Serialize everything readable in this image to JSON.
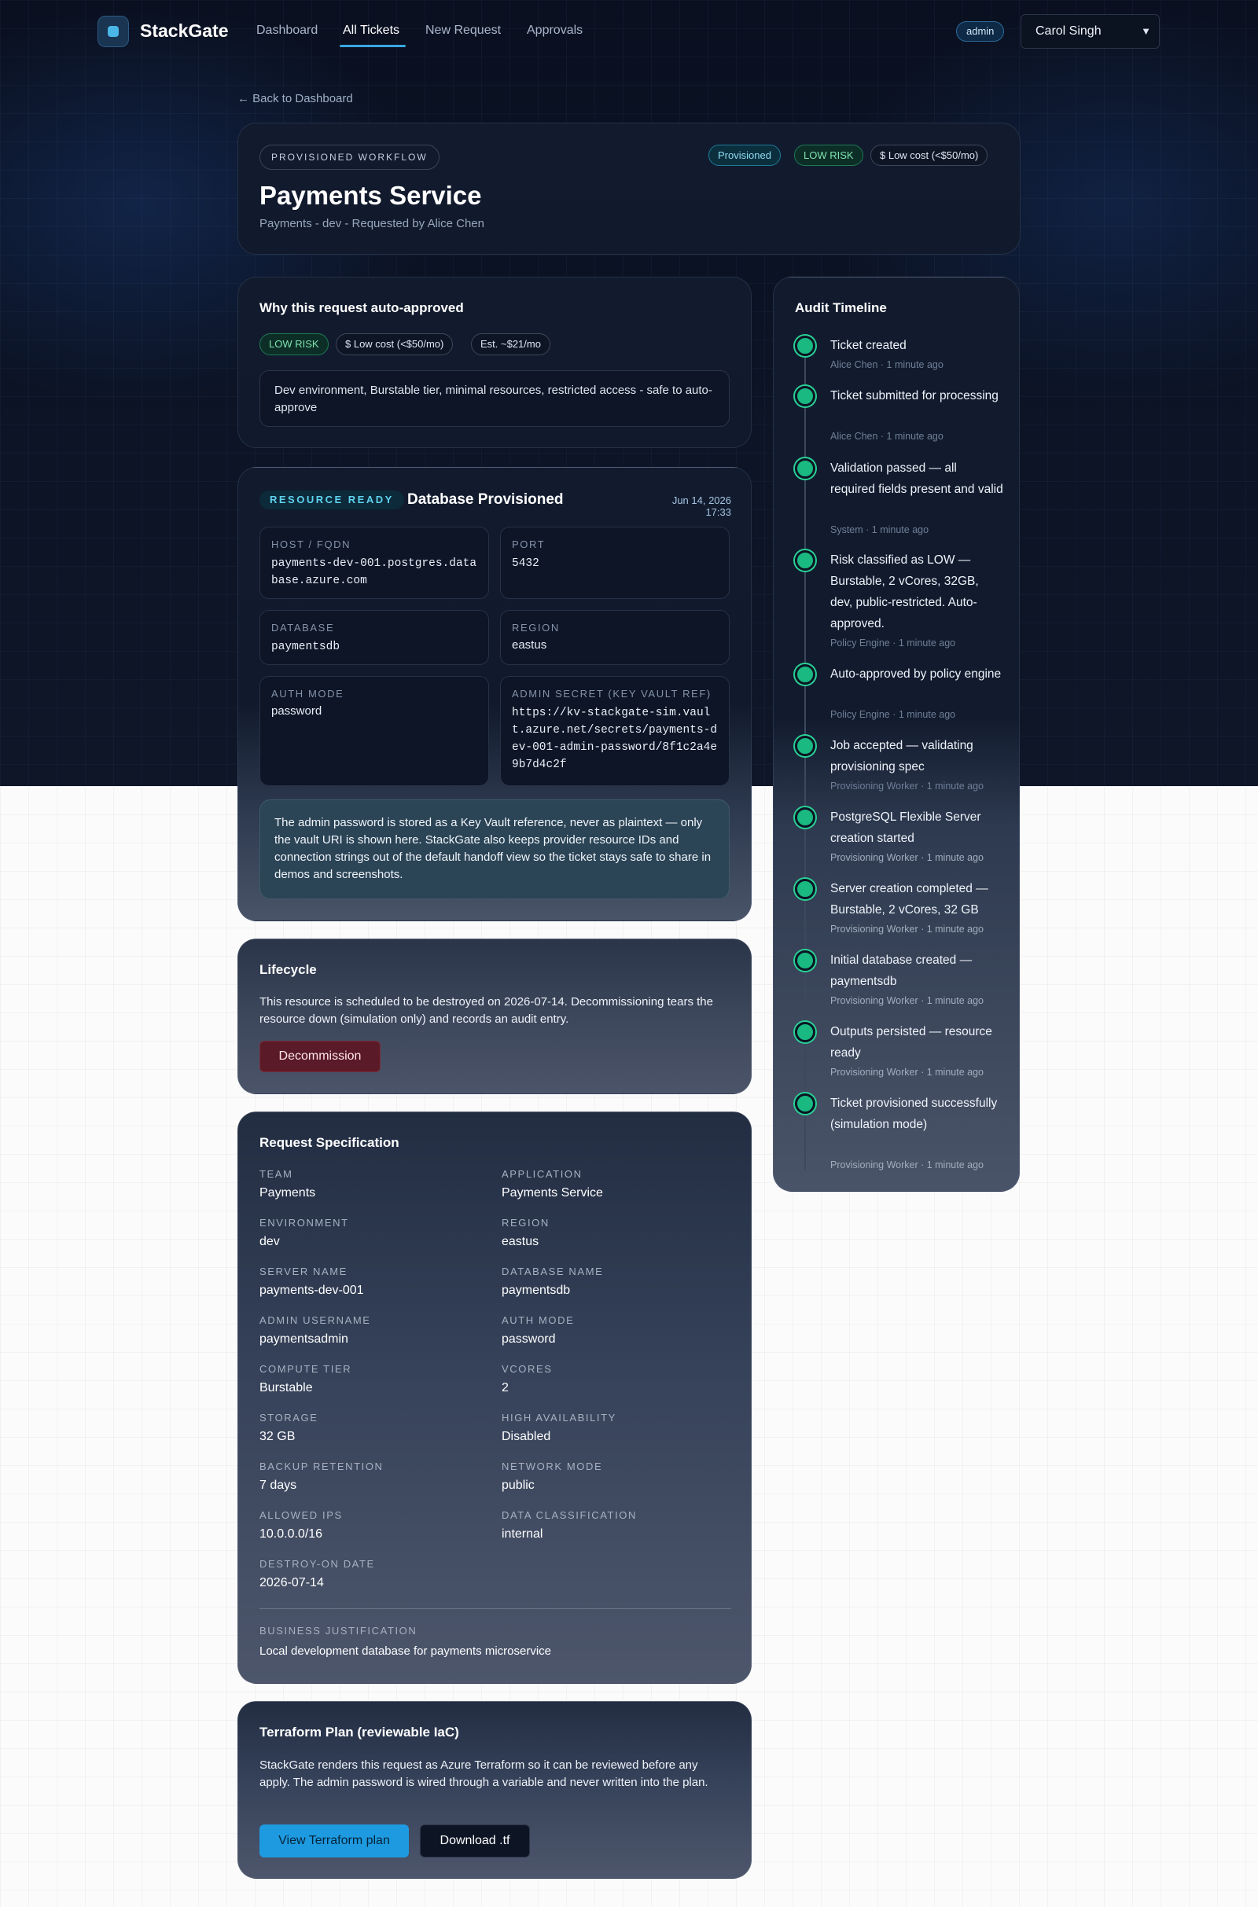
{
  "nav": {
    "brand": "StackGate",
    "links": [
      "Dashboard",
      "All Tickets",
      "New Request",
      "Approvals"
    ],
    "active": "All Tickets",
    "role": "admin",
    "user": "Carol Singh"
  },
  "back_link": "← Back to Dashboard",
  "header": {
    "eyebrow": "PROVISIONED WORKFLOW",
    "title": "Payments Service",
    "subtitle": "Payments - dev - Requested by Alice Chen",
    "badges": [
      "Provisioned",
      "LOW RISK",
      "$ Low cost (<$50/mo)"
    ]
  },
  "auto_approve": {
    "title": "Why this request auto-approved",
    "chips": [
      "LOW RISK",
      "$ Low cost (<$50/mo)",
      "Est. ~$21/mo"
    ],
    "reason": "Dev environment, Burstable tier, minimal resources, restricted access - safe to auto-approve"
  },
  "provisioned": {
    "tag": "RESOURCE READY",
    "title": "Database Provisioned",
    "date": "Jun 14, 2026 17:33",
    "host_label": "HOST / FQDN",
    "host": "payments-dev-001.postgres.database.azure.com",
    "port_label": "PORT",
    "port": "5432",
    "database_label": "DATABASE",
    "database": "paymentsdb",
    "region_label": "REGION",
    "region": "eastus",
    "auth_label": "AUTH MODE",
    "auth": "password",
    "secret_label": "ADMIN SECRET (KEY VAULT REF)",
    "secret": "https://kv-stackgate-sim.vault.azure.net/secrets/payments-dev-001-admin-password/8f1c2a4e9b7d4c2f",
    "info": "The admin password is stored as a Key Vault reference, never as plaintext — only the vault URI is shown here. StackGate also keeps provider resource IDs and connection strings out of the default handoff view so the ticket stays safe to share in demos and screenshots."
  },
  "lifecycle": {
    "title": "Lifecycle",
    "text": "This resource is scheduled to be destroyed on 2026-07-14. Decommissioning tears the resource down (simulation only) and records an audit entry.",
    "button": "Decommission"
  },
  "spec": {
    "title": "Request Specification",
    "fields": [
      {
        "label": "TEAM",
        "value": "Payments"
      },
      {
        "label": "APPLICATION",
        "value": "Payments Service"
      },
      {
        "label": "ENVIRONMENT",
        "value": "dev"
      },
      {
        "label": "REGION",
        "value": "eastus"
      },
      {
        "label": "SERVER NAME",
        "value": "payments-dev-001"
      },
      {
        "label": "DATABASE NAME",
        "value": "paymentsdb"
      },
      {
        "label": "ADMIN USERNAME",
        "value": "paymentsadmin"
      },
      {
        "label": "AUTH MODE",
        "value": "password"
      },
      {
        "label": "COMPUTE TIER",
        "value": "Burstable"
      },
      {
        "label": "VCORES",
        "value": "2"
      },
      {
        "label": "STORAGE",
        "value": "32 GB"
      },
      {
        "label": "HIGH AVAILABILITY",
        "value": "Disabled"
      },
      {
        "label": "BACKUP RETENTION",
        "value": "7 days"
      },
      {
        "label": "NETWORK MODE",
        "value": "public"
      },
      {
        "label": "ALLOWED IPS",
        "value": "10.0.0.0/16"
      },
      {
        "label": "DATA CLASSIFICATION",
        "value": "internal"
      },
      {
        "label": "DESTROY-ON DATE",
        "value": "2026-07-14"
      }
    ],
    "justification_label": "BUSINESS JUSTIFICATION",
    "justification": "Local development database for payments microservice"
  },
  "terraform": {
    "title": "Terraform Plan (reviewable IaC)",
    "text": "StackGate renders this request as Azure Terraform so it can be reviewed before any apply. The admin password is wired through a variable and never written into the plan.",
    "view_button": "View Terraform plan",
    "download_button": "Download .tf"
  },
  "timeline": {
    "title": "Audit Timeline",
    "events": [
      {
        "title": "Ticket created",
        "meta": "Alice Chen · 1 minute ago"
      },
      {
        "title": "Ticket submitted for processing",
        "meta": "Alice Chen · 1 minute ago"
      },
      {
        "title": "Validation passed — all required fields present and valid",
        "meta": "System · 1 minute ago"
      },
      {
        "title": "Risk classified as LOW — Burstable, 2 vCores, 32GB, dev, public-restricted. Auto-approved.",
        "meta": "Policy Engine · 1 minute ago"
      },
      {
        "title": "Auto-approved by policy engine",
        "meta": "Policy Engine · 1 minute ago"
      },
      {
        "title": "Job accepted — validating provisioning spec",
        "meta": "Provisioning Worker · 1 minute ago"
      },
      {
        "title": "PostgreSQL Flexible Server creation started",
        "meta": "Provisioning Worker · 1 minute ago"
      },
      {
        "title": "Server creation completed — Burstable, 2 vCores, 32 GB",
        "meta": "Provisioning Worker · 1 minute ago"
      },
      {
        "title": "Initial database created — paymentsdb",
        "meta": "Provisioning Worker · 1 minute ago"
      },
      {
        "title": "Outputs persisted — resource ready",
        "meta": "Provisioning Worker · 1 minute ago"
      },
      {
        "title": "Ticket provisioned successfully (simulation mode)",
        "meta": "Provisioning Worker · 1 minute ago"
      }
    ]
  },
  "colors": {
    "accent": "#1e9ae0",
    "success": "#19b981",
    "danger": "#5a1a28",
    "dark_bg": "#0c1426"
  }
}
